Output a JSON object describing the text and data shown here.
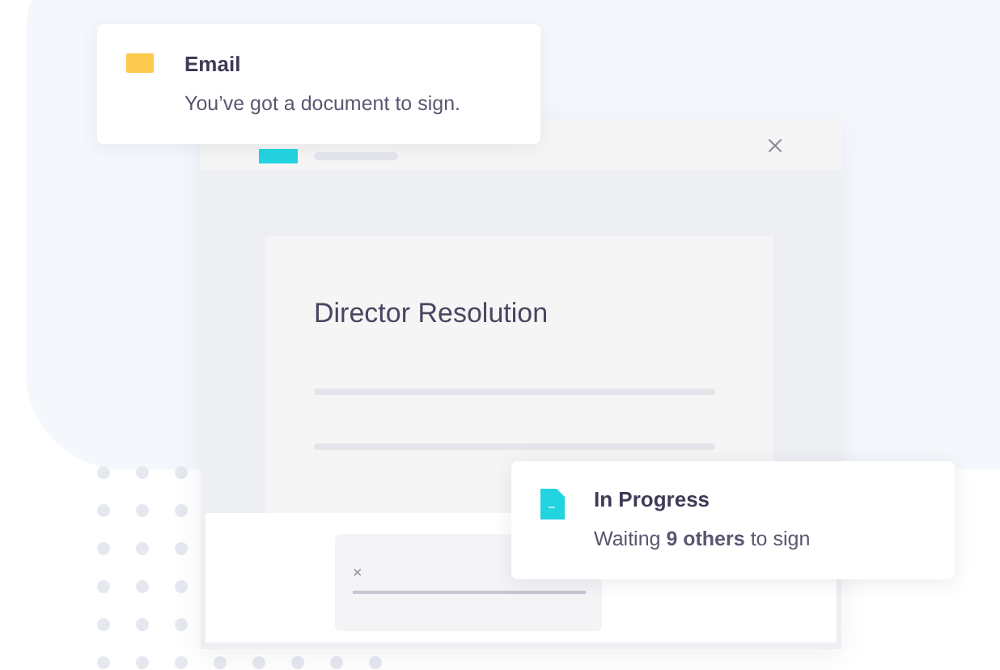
{
  "email_card": {
    "title": "Email",
    "message": "You’ve got a document to sign."
  },
  "document": {
    "title": "Director Resolution"
  },
  "signature": {
    "mark": "×"
  },
  "status_card": {
    "title": "In Progress",
    "message": "Waiting **9 others** to sign"
  }
}
